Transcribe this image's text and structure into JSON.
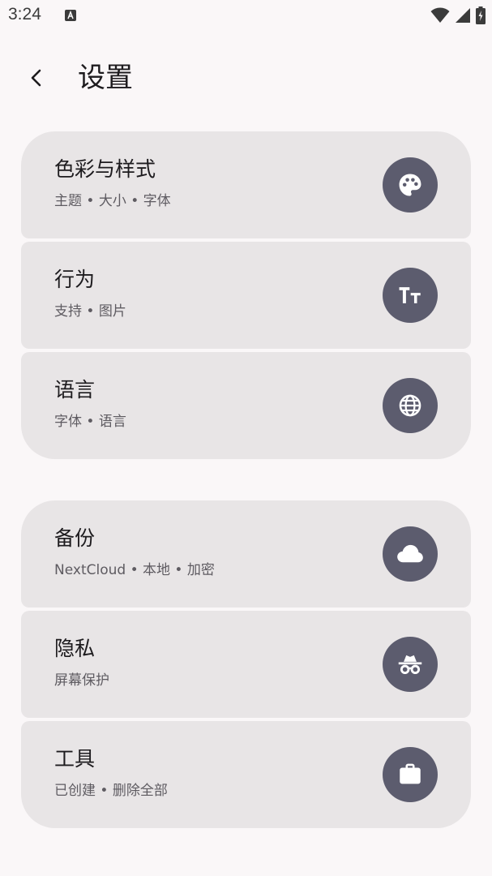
{
  "status_bar": {
    "time": "3:24",
    "notification_icon": "a-icon",
    "wifi_icon": "wifi-icon",
    "signal_icon": "signal-icon",
    "battery_icon": "battery-charging-icon"
  },
  "app_bar": {
    "back_icon": "back-arrow-icon",
    "title": "设置"
  },
  "groups": [
    {
      "items": [
        {
          "title": "色彩与样式",
          "subtitle": "主题 • 大小 • 字体",
          "icon": "palette-icon"
        },
        {
          "title": "行为",
          "subtitle": "支持 • 图片",
          "icon": "text-size-icon"
        },
        {
          "title": "语言",
          "subtitle": "字体 • 语言",
          "icon": "globe-icon"
        }
      ]
    },
    {
      "items": [
        {
          "title": "备份",
          "subtitle": "NextCloud • 本地 • 加密",
          "icon": "cloud-icon"
        },
        {
          "title": "隐私",
          "subtitle": "屏幕保护",
          "icon": "incognito-icon"
        },
        {
          "title": "工具",
          "subtitle": "已创建 • 删除全部",
          "icon": "briefcase-icon"
        }
      ]
    }
  ],
  "colors": {
    "background": "#faf7f8",
    "card": "#e8e5e6",
    "icon_circle": "#5c5c6e",
    "icon_glyph": "#ffffff"
  }
}
